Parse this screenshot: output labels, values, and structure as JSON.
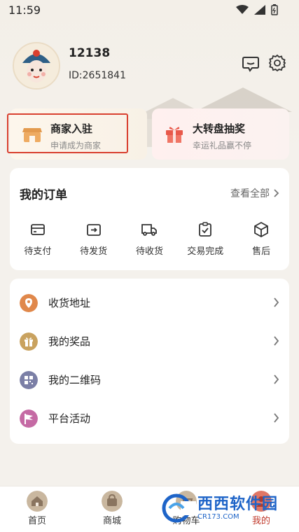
{
  "status": {
    "time": "11:59"
  },
  "profile": {
    "username": "12138",
    "user_id": "ID:2651841"
  },
  "promos": {
    "merchant": {
      "title": "商家入驻",
      "subtitle": "申请成为商家",
      "icon": "shop-icon"
    },
    "lottery": {
      "title": "大转盘抽奖",
      "subtitle": "幸运礼品赢不停",
      "icon": "gift-icon"
    }
  },
  "orders": {
    "title": "我的订单",
    "view_all": "查看全部",
    "items": [
      {
        "label": "待支付",
        "icon": "wallet-icon"
      },
      {
        "label": "待发货",
        "icon": "ship-box-icon"
      },
      {
        "label": "待收货",
        "icon": "truck-icon"
      },
      {
        "label": "交易完成",
        "icon": "clipboard-check-icon"
      },
      {
        "label": "售后",
        "icon": "package-icon"
      }
    ]
  },
  "menu": {
    "items": [
      {
        "label": "收货地址",
        "icon": "location-pin-icon",
        "color": "#e0884b"
      },
      {
        "label": "我的奖品",
        "icon": "gift-icon",
        "color": "#c9a25f"
      },
      {
        "label": "我的二维码",
        "icon": "qr-code-icon",
        "color": "#7b7fa6"
      },
      {
        "label": "平台活动",
        "icon": "flag-icon",
        "color": "#c56aa4"
      }
    ]
  },
  "tabbar": {
    "tabs": [
      {
        "label": "首页",
        "icon": "home-icon"
      },
      {
        "label": "商城",
        "icon": "shop-bag-icon"
      },
      {
        "label": "购物车",
        "icon": "cart-icon"
      },
      {
        "label": "我的",
        "icon": "user-icon"
      }
    ]
  },
  "watermark": {
    "main": "西西软件园",
    "sub": "CR173.COM"
  },
  "colors": {
    "accent_red": "#d9402f",
    "background": "#f4f1ec",
    "link_gray": "#666666"
  }
}
